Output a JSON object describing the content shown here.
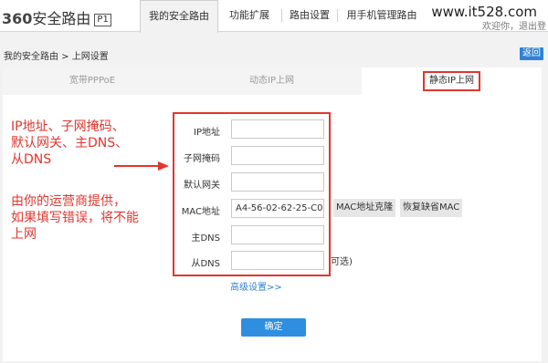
{
  "header": {
    "logo_num": "360",
    "logo_text": "安全路由",
    "logo_badge": "P1",
    "watermark": "www.it528.com",
    "user_info": "欢迎你，退出登",
    "tabs": [
      {
        "label": "我的安全路由",
        "active": true
      },
      {
        "label": "功能扩展"
      },
      {
        "label": "路由设置"
      },
      {
        "label": "用手机管理路由"
      }
    ]
  },
  "breadcrumb": "我的安全路由 > 上网设置",
  "back_label": "返回",
  "subtabs": [
    {
      "label": "宽带PPPoE"
    },
    {
      "label": "动态IP上网"
    },
    {
      "label": "静态IP上网",
      "active": true
    }
  ],
  "annotation": {
    "lines1": [
      "IP地址、子网掩码、",
      "默认网关、主DNS、",
      "从DNS"
    ],
    "lines2": [
      "由你的运营商提供，",
      "如果填写错误，将不能",
      "上网"
    ]
  },
  "form": {
    "fields": [
      {
        "label": "IP地址",
        "value": ""
      },
      {
        "label": "子网掩码",
        "value": ""
      },
      {
        "label": "默认网关",
        "value": ""
      },
      {
        "label": "MAC地址",
        "value": "A4-56-02-62-25-C0"
      },
      {
        "label": "主DNS",
        "value": ""
      },
      {
        "label": "从DNS",
        "value": ""
      }
    ],
    "mac_clone_label": "MAC地址克隆",
    "mac_restore_label": "恢复缺省MAC",
    "optional_text": "可选)",
    "advanced_label": "高级设置>>",
    "ok_label": "确定"
  },
  "colors": {
    "annotation_red": "#e0362e",
    "primary_blue": "#2f8ee0"
  }
}
